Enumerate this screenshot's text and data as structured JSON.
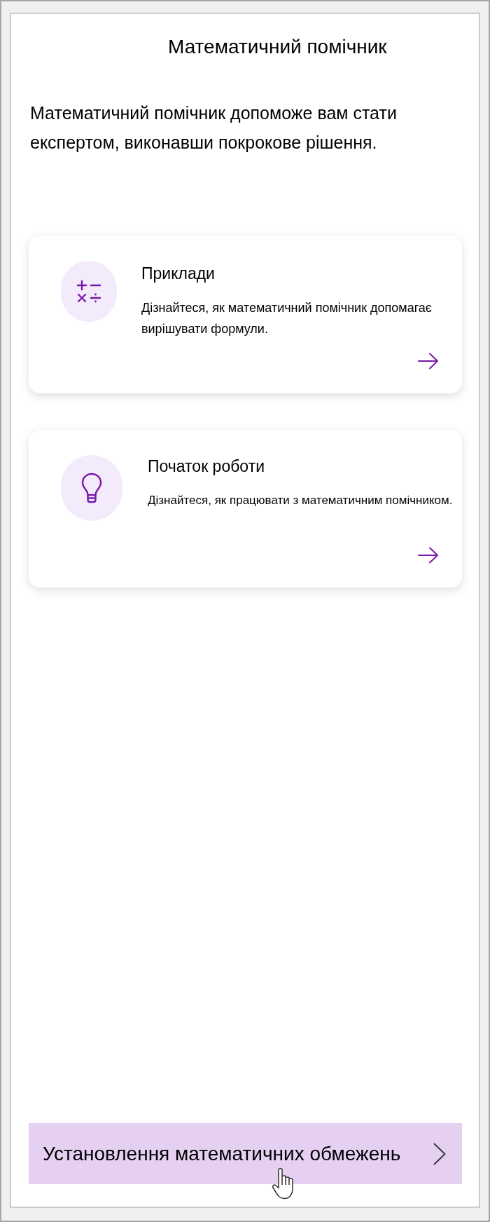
{
  "header": {
    "title": "Математичний помічник"
  },
  "intro": "Математичний помічник допоможе вам стати експертом, виконавши покрокове рішення.",
  "cards": [
    {
      "kind": "operators",
      "title": "Приклади",
      "description": "Дізнайтеся, як математичний помічник допомагає вирішувати формули."
    },
    {
      "kind": "lightbulb",
      "title": "Початок роботи",
      "description": "Дізнайтеся, як працювати з математичним помічником."
    }
  ],
  "footer_button": {
    "label": "Установлення математичних обмежень"
  }
}
